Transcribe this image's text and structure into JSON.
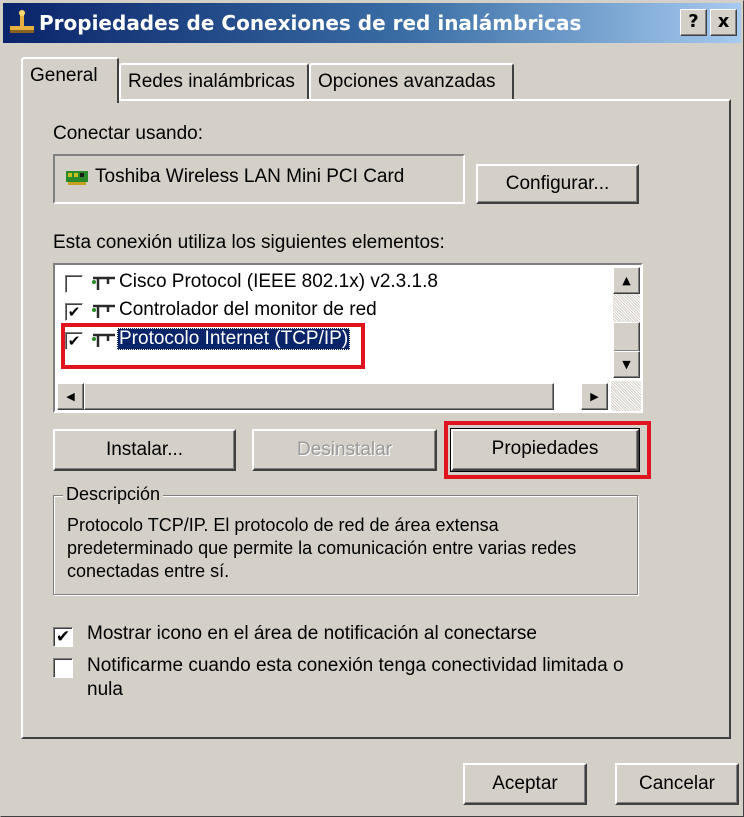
{
  "window": {
    "title": "Propiedades de Conexiones de red inalámbricas",
    "help_button": "?",
    "close_button": "x"
  },
  "tabs": [
    {
      "label": "General",
      "active": true
    },
    {
      "label": "Redes inalámbricas",
      "active": false
    },
    {
      "label": "Opciones avanzadas",
      "active": false
    }
  ],
  "connect_using": {
    "label": "Conectar usando:",
    "adapter": "Toshiba Wireless LAN Mini PCI Card",
    "configure_button": "Configurar..."
  },
  "components": {
    "label": "Esta conexión utiliza los siguientes elementos:",
    "items": [
      {
        "label": "Cisco Protocol (IEEE 802.1x) v2.3.1.8",
        "checked": false,
        "selected": false
      },
      {
        "label": "Controlador del monitor de red",
        "checked": true,
        "selected": false
      },
      {
        "label": "Protocolo Internet (TCP/IP)",
        "checked": true,
        "selected": true
      }
    ],
    "check_mark": "✔"
  },
  "buttons": {
    "install": "Instalar...",
    "uninstall": "Desinstalar",
    "properties": "Propiedades",
    "ok": "Aceptar",
    "cancel": "Cancelar"
  },
  "description": {
    "legend": "Descripción",
    "text": "Protocolo TCP/IP. El protocolo de red de área extensa predeterminado que permite la comunicación entre varias redes conectadas entre sí."
  },
  "options": [
    {
      "label": "Mostrar icono en el área de notificación al conectarse",
      "checked": true
    },
    {
      "label": "Notificarme cuando esta conexión tenga conectividad limitada o nula",
      "checked": false
    }
  ],
  "colors": {
    "dialog_face": "#d4d0c8",
    "title_gradient_start": "#0a246a",
    "selection": "#0a246a",
    "annotation_red": "#e0141e"
  },
  "scrollbar_glyphs": {
    "up": "▲",
    "down": "▼",
    "left": "◀",
    "right": "▶"
  }
}
